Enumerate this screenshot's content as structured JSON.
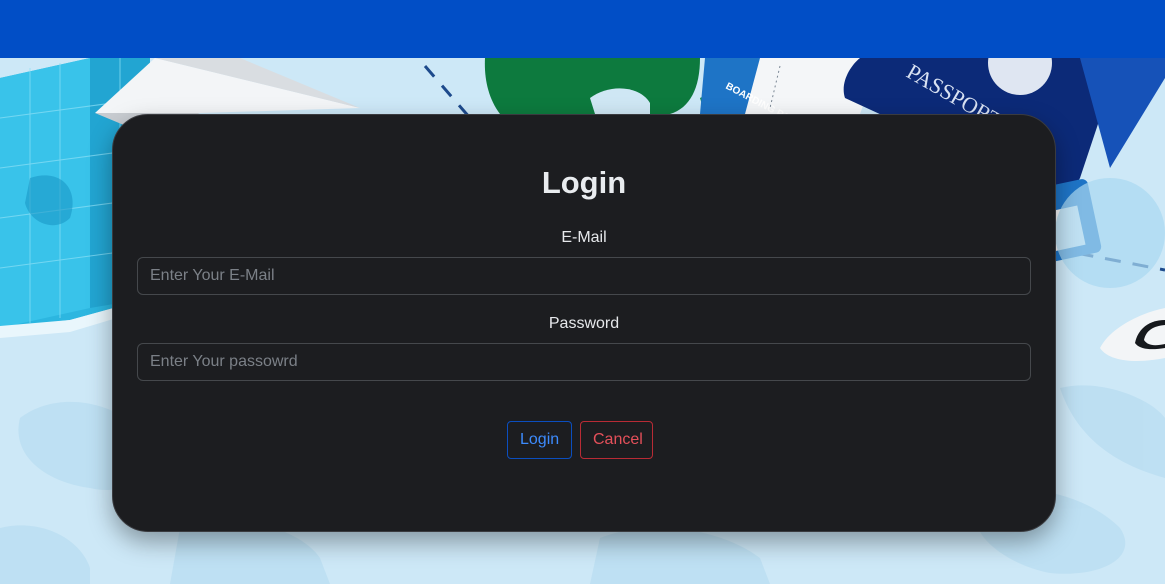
{
  "colors": {
    "topbar": "#014ec6",
    "card": "#1c1d20",
    "login_accent": "#3d8bfd",
    "cancel_accent": "#e4505a"
  },
  "login_form": {
    "title": "Login",
    "email_label": "E-Mail",
    "email_placeholder": "Enter Your E-Mail",
    "email_value": "",
    "password_label": "Password",
    "password_placeholder": "Enter Your passowrd",
    "password_value": "",
    "login_button": "Login",
    "cancel_button": "Cancel"
  },
  "background": {
    "boarding_pass_text": "BOARDING PASS",
    "passport_text": "PASSPORT"
  }
}
